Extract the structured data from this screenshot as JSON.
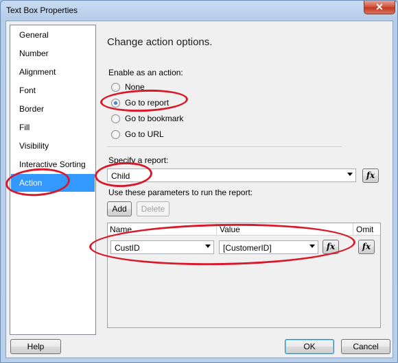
{
  "window": {
    "title": "Text Box Properties",
    "close_glyph": "✕"
  },
  "nav": {
    "items": [
      {
        "label": "General",
        "selected": false
      },
      {
        "label": "Number",
        "selected": false
      },
      {
        "label": "Alignment",
        "selected": false
      },
      {
        "label": "Font",
        "selected": false
      },
      {
        "label": "Border",
        "selected": false
      },
      {
        "label": "Fill",
        "selected": false
      },
      {
        "label": "Visibility",
        "selected": false
      },
      {
        "label": "Interactive Sorting",
        "selected": false
      },
      {
        "label": "Action",
        "selected": true
      }
    ]
  },
  "content": {
    "heading": "Change action options.",
    "enable_label": "Enable as an action:",
    "radios": [
      {
        "label": "None",
        "checked": false
      },
      {
        "label": "Go to report",
        "checked": true
      },
      {
        "label": "Go to bookmark",
        "checked": false
      },
      {
        "label": "Go to URL",
        "checked": false
      }
    ],
    "report_label": "Specify a report:",
    "report_value": "Child",
    "params_label": "Use these parameters to run the report:",
    "add_label": "Add",
    "delete_label": "Delete",
    "fx_label": "fx",
    "grid": {
      "columns": [
        "Name",
        "Value",
        "Omit"
      ],
      "rows": [
        {
          "name": "CustID",
          "value": "[CustomerID]"
        }
      ]
    }
  },
  "footer": {
    "help_label": "Help",
    "ok_label": "OK",
    "cancel_label": "Cancel"
  },
  "colors": {
    "selection": "#3399ff",
    "annotation": "#d8192a"
  }
}
